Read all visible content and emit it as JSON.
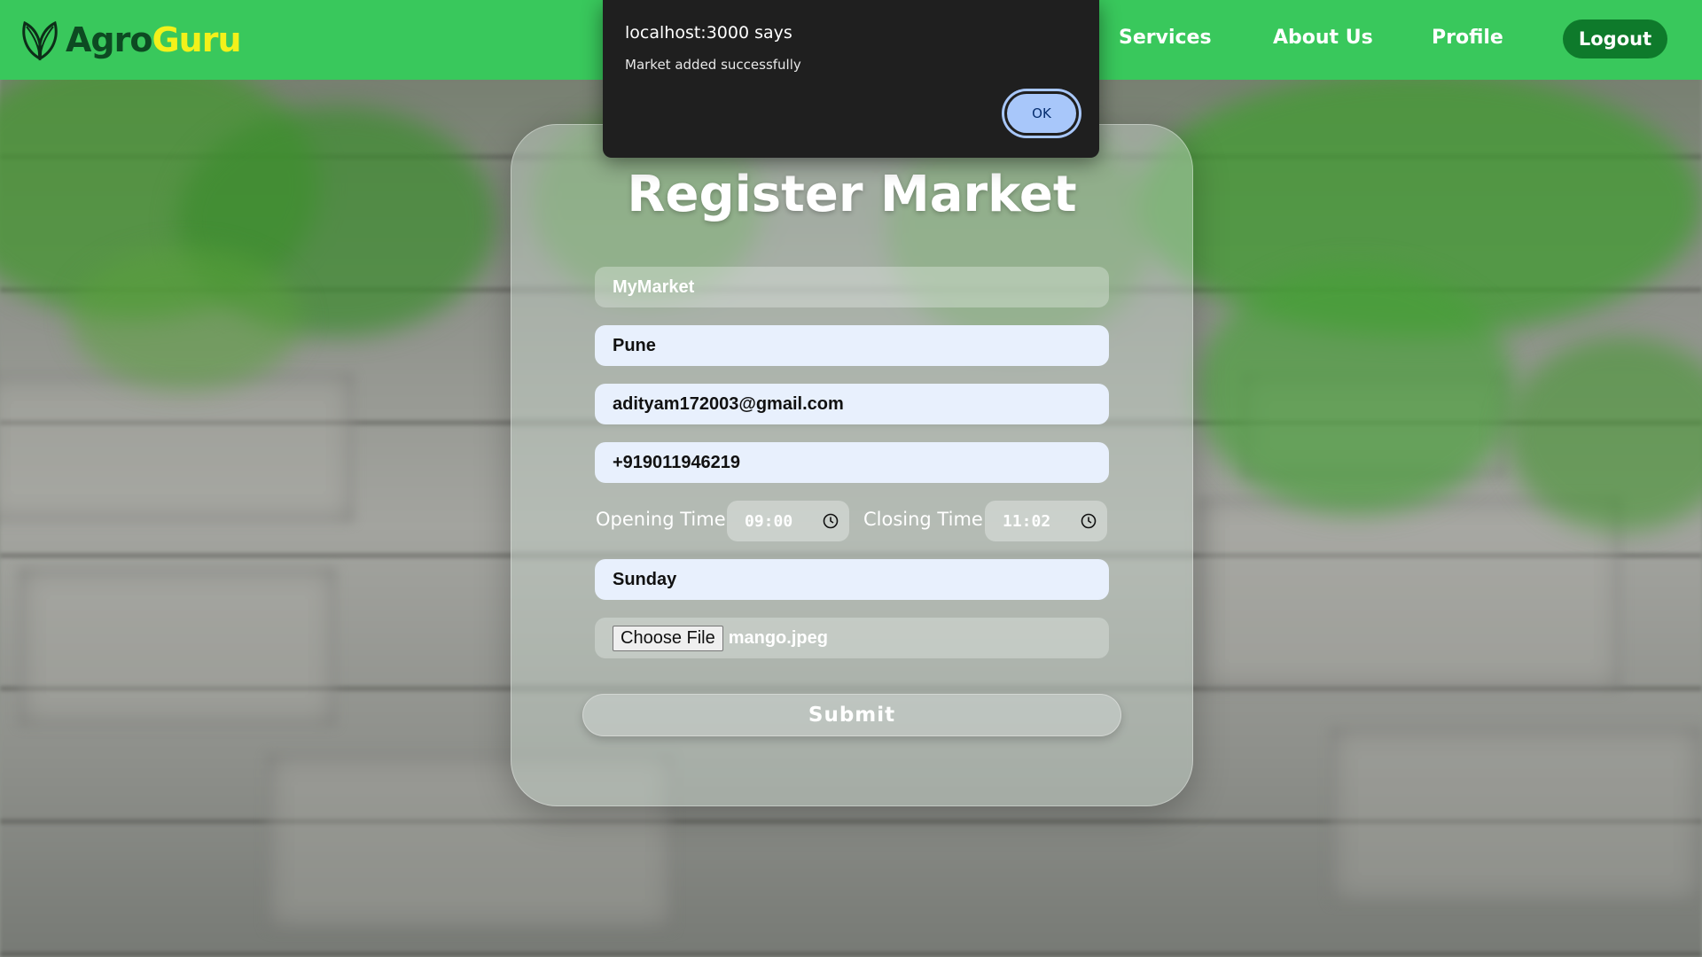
{
  "nav": {
    "logo_part1": "Agro",
    "logo_part2": "Guru",
    "links": [
      "Services",
      "About Us",
      "Profile"
    ],
    "logout_label": "Logout"
  },
  "dialog": {
    "title": "localhost:3000 says",
    "message": "Market added successfully",
    "ok_label": "OK"
  },
  "form": {
    "title": "Register Market",
    "market_name": "MyMarket",
    "city": "Pune",
    "email": "adityam172003@gmail.com",
    "phone": "+919011946219",
    "opening_label": "Opening Time",
    "opening_time": "09:00",
    "closing_label": "Closing Time",
    "closing_time": "11:02",
    "day": "Sunday",
    "choose_file_label": "Choose File",
    "file_name": "mango.jpeg",
    "submit_label": "Submit"
  },
  "colors": {
    "navbar": "#39c85c",
    "logout": "#0e7a2b",
    "logo_dark": "#0d4a22",
    "logo_yellow": "#f3f11a",
    "dialog_bg": "#1f1f1f",
    "ok_button": "#a8c7fa"
  },
  "icons": [
    "leaf-logo-icon",
    "clock-icon"
  ]
}
